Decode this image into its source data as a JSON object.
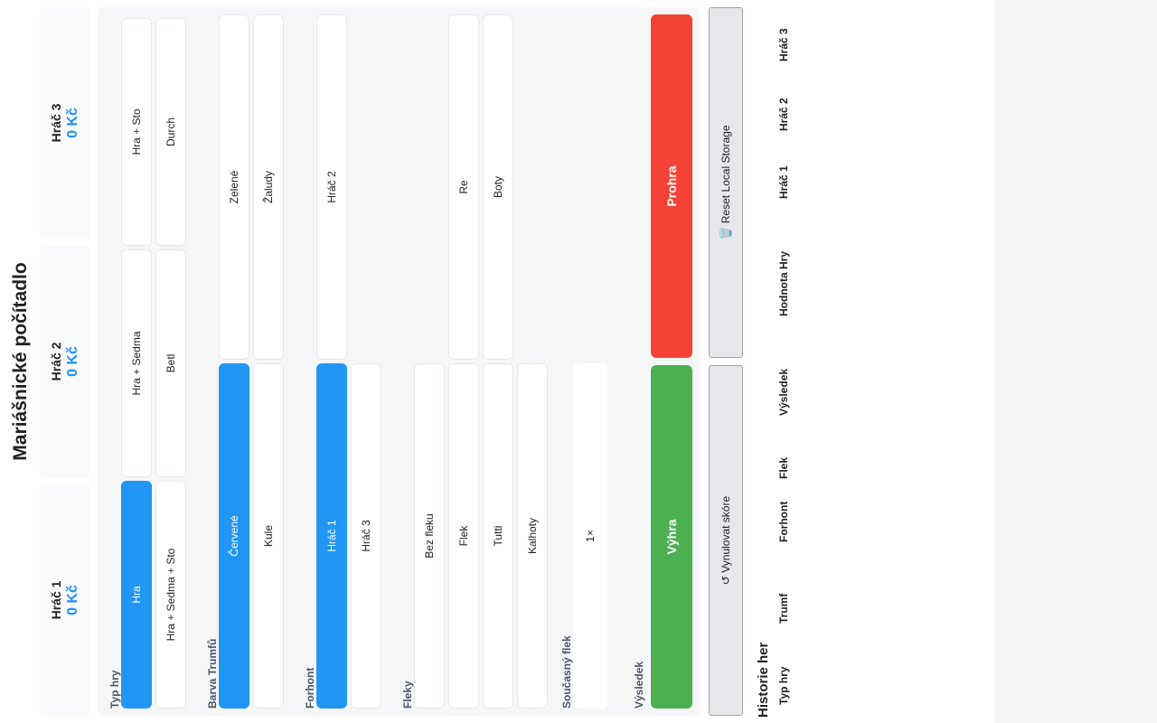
{
  "app": {
    "title": "Mariášnické počítadlo"
  },
  "players": [
    {
      "name": "Hráč 1",
      "score": "0 Kč"
    },
    {
      "name": "Hráč 2",
      "score": "0 Kč"
    },
    {
      "name": "Hráč 3",
      "score": "0 Kč"
    }
  ],
  "game_type": {
    "label": "Typ hry",
    "options": [
      "Hra",
      "Hra + Sedma",
      "Hra + Sto",
      "Hra + Sedma + Sto",
      "Betl",
      "Durch"
    ],
    "selected": "Hra"
  },
  "trump": {
    "label": "Barva Trumfů",
    "options": [
      "Červené",
      "Zelené",
      "Kule",
      "Žaludy"
    ],
    "selected": "Červené"
  },
  "forhont": {
    "label": "Forhont",
    "options": [
      "Hráč 1",
      "Hráč 2",
      "Hráč 3"
    ],
    "selected": "Hráč 1"
  },
  "fleky": {
    "label": "Fleky",
    "options": [
      "Bez fleku",
      "Flek",
      "Re",
      "Tutti",
      "Boty",
      "Kalhoty"
    ]
  },
  "current_flek": {
    "label": "Současný flek",
    "value": "1×"
  },
  "result": {
    "label": "Výsledek",
    "win": "Výhra",
    "lose": "Prohra"
  },
  "actions": {
    "reset_score": "↺ Vynulovat skóre",
    "reset_storage": "🗑️ Reset Local Storage"
  },
  "history": {
    "title": "Historie her",
    "columns": [
      "Typ hry",
      "Trumf",
      "Forhont",
      "Flek",
      "Výsledek",
      "Hodnota Hry",
      "Hráč 1",
      "Hráč 2",
      "Hráč 3"
    ]
  },
  "colors": {
    "accent": "#2196f3",
    "score": "#1e90ff",
    "win": "#4caf50",
    "lose": "#f44336"
  }
}
